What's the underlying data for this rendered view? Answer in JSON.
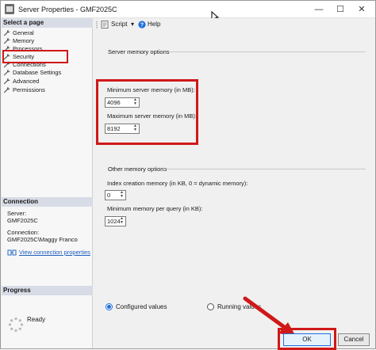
{
  "window": {
    "title": "Server Properties - GMF2025C",
    "min_glyph": "—",
    "max_glyph": "☐",
    "close_glyph": "✕"
  },
  "left": {
    "select_page_header": "Select a page",
    "pages": [
      {
        "label": "General",
        "icon": "wrench-icon"
      },
      {
        "label": "Memory",
        "icon": "wrench-icon"
      },
      {
        "label": "Processors",
        "icon": "wrench-icon"
      },
      {
        "label": "Security",
        "icon": "wrench-icon"
      },
      {
        "label": "Connections",
        "icon": "wrench-icon"
      },
      {
        "label": "Database Settings",
        "icon": "wrench-icon"
      },
      {
        "label": "Advanced",
        "icon": "wrench-icon"
      },
      {
        "label": "Permissions",
        "icon": "wrench-icon"
      }
    ],
    "connection_header": "Connection",
    "server_label": "Server:",
    "server_value": "GMF2025C",
    "connection_label": "Connection:",
    "connection_value": "GMF2025C\\Maggy Franco",
    "view_connection_link": "View connection properties",
    "progress_header": "Progress",
    "progress_status": "Ready"
  },
  "toolbar": {
    "script_label": "Script",
    "script_dropdown_glyph": "▾",
    "help_label": "Help"
  },
  "main": {
    "server_memory_group": "Server memory options",
    "min_memory_label": "Minimum server memory (in MB):",
    "min_memory_value": "4096",
    "max_memory_label": "Maximum server memory (in MB):",
    "max_memory_value": "8192",
    "other_memory_group": "Other memory options",
    "index_memory_label": "Index creation memory (in KB, 0 = dynamic memory):",
    "index_memory_value": "0",
    "min_query_memory_label": "Minimum memory per query (in KB):",
    "min_query_memory_value": "1024",
    "configured_values_label": "Configured values",
    "running_values_label": "Running values",
    "configured_selected": true
  },
  "buttons": {
    "ok_label": "OK",
    "cancel_label": "Cancel"
  },
  "colors": {
    "highlight_red": "#d01818",
    "accent_blue": "#1f6fe0",
    "link_blue": "#1f5fbf"
  }
}
